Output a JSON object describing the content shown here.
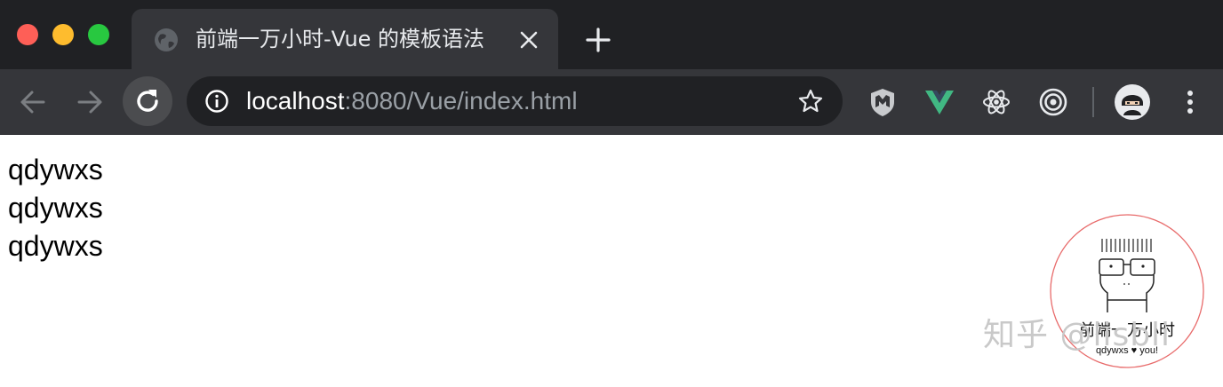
{
  "window": {
    "traffic_lights": {
      "close": "#fe5f57",
      "minimize": "#febc2e",
      "zoom": "#28c840"
    }
  },
  "tab": {
    "title": "前端一万小时-Vue 的模板语法",
    "favicon": "globe-icon"
  },
  "toolbar": {
    "url_host": "localhost",
    "url_path": ":8080/Vue/index.html",
    "extensions": [
      "mcafee-shield-icon",
      "vue-devtools-icon",
      "react-devtools-icon",
      "target-icon"
    ]
  },
  "page": {
    "lines": [
      "qdywxs",
      "qdywxs",
      "qdywxs"
    ]
  },
  "stamp": {
    "title": "前端一万小时",
    "subtitle": "qdywxs ♥ you!",
    "border_color": "#e86b6b"
  },
  "watermark": {
    "text": "知乎 @lisbli"
  },
  "colors": {
    "titlebar": "#202124",
    "toolbar": "#35363a",
    "omnibox": "#202124",
    "vue_green": "#41b883"
  }
}
